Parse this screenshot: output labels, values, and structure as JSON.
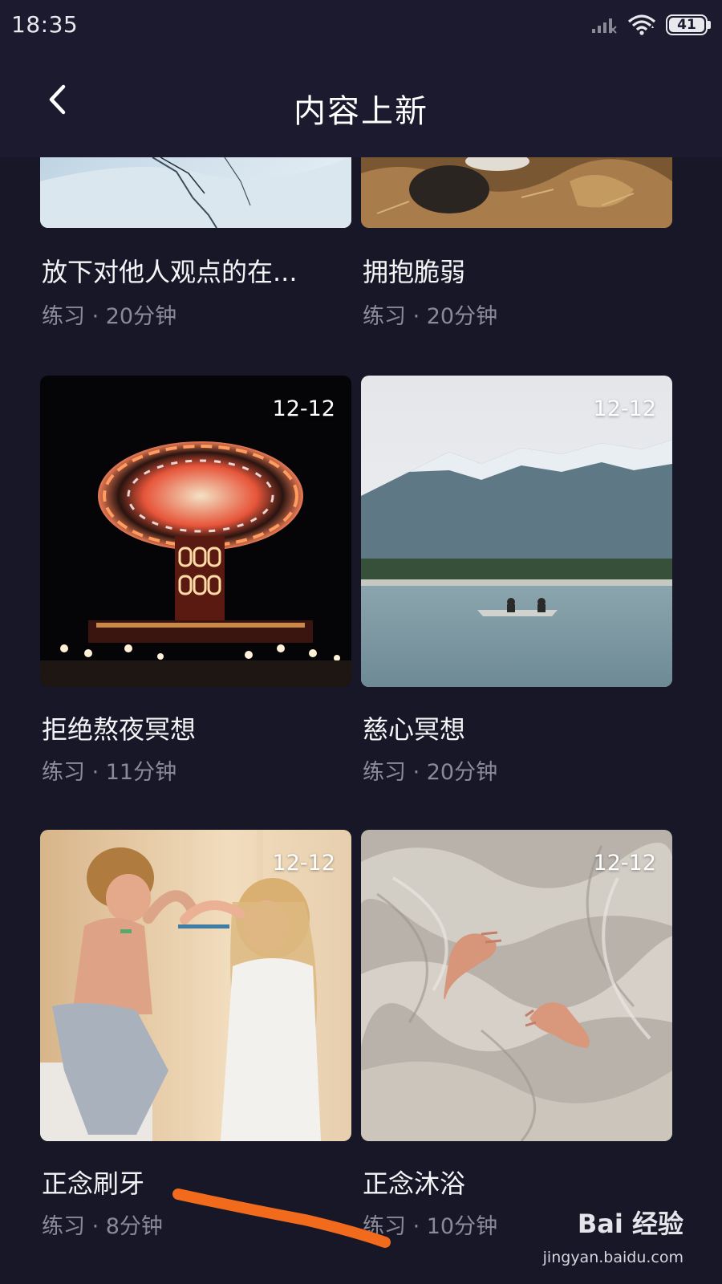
{
  "status_bar": {
    "time": "18:35",
    "battery": "41",
    "icons": [
      "signal-icon",
      "wifi-icon",
      "battery-icon"
    ]
  },
  "header": {
    "title": "内容上新",
    "back_icon": "chevron-left-icon"
  },
  "cards": [
    {
      "title": "放下对他人观点的在...",
      "meta": "练习 · 20分钟",
      "date": ""
    },
    {
      "title": "拥抱脆弱",
      "meta": "练习 · 20分钟",
      "date": ""
    },
    {
      "title": "拒绝熬夜冥想",
      "meta": "练习 · 11分钟",
      "date": "12-12"
    },
    {
      "title": "慈心冥想",
      "meta": "练习 · 20分钟",
      "date": "12-12"
    },
    {
      "title": "正念刷牙",
      "meta": "练习 · 8分钟",
      "date": "12-12"
    },
    {
      "title": "正念沐浴",
      "meta": "练习 · 10分钟",
      "date": "12-12"
    }
  ],
  "watermark": {
    "logo": "Bai 经验",
    "url": "jingyan.baidu.com"
  },
  "colors": {
    "background": "#171727",
    "header": "#1b1a2e",
    "meta_text": "#8b8a98",
    "annotation": "#f26a1b"
  }
}
